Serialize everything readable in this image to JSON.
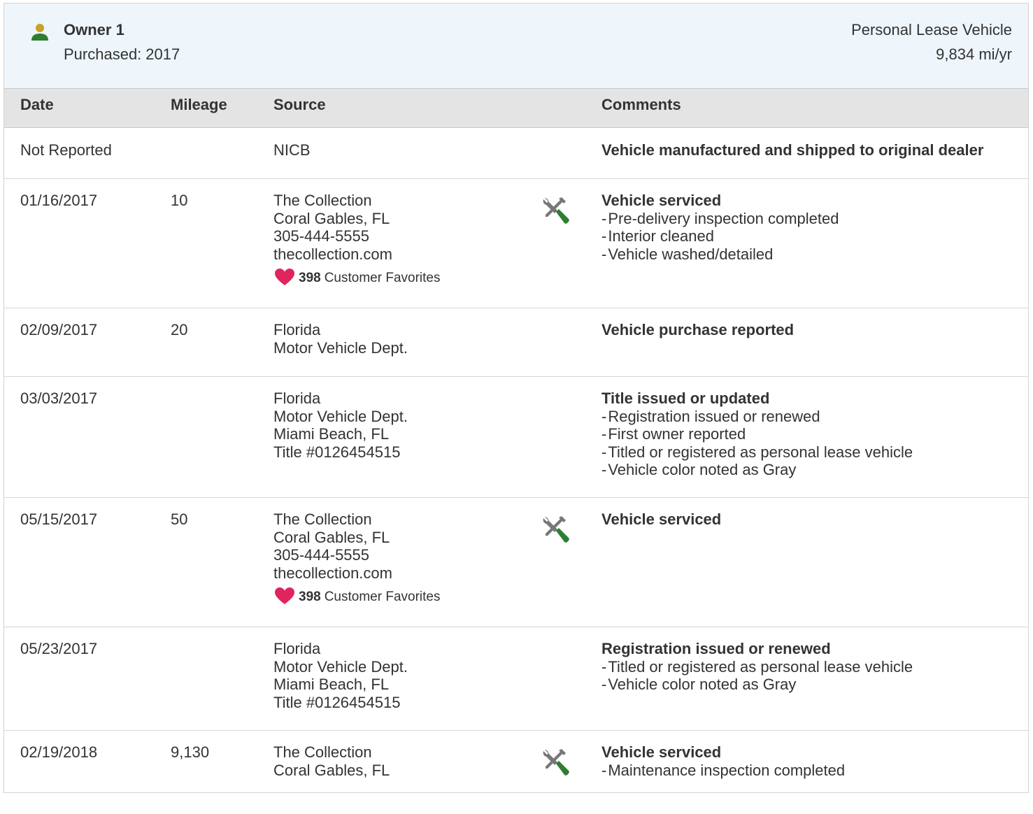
{
  "owner": {
    "title": "Owner 1",
    "purchased_label": "Purchased:",
    "purchased_year": "2017",
    "vehicle_type": "Personal Lease Vehicle",
    "miles_per_year": "9,834 mi/yr"
  },
  "table": {
    "columns": [
      "Date",
      "Mileage",
      "Source",
      "Comments"
    ],
    "rows": [
      {
        "date": "Not Reported",
        "mileage": "",
        "source": [
          "NICB"
        ],
        "favorites": null,
        "service_icon": false,
        "comment_title": "Vehicle manufactured and shipped to original dealer",
        "comment_items": []
      },
      {
        "date": "01/16/2017",
        "mileage": "10",
        "source": [
          "The Collection",
          "Coral Gables, FL",
          "305-444-5555",
          "thecollection.com"
        ],
        "favorites": {
          "count": "398",
          "label": "Customer Favorites"
        },
        "service_icon": true,
        "comment_title": "Vehicle serviced",
        "comment_items": [
          "Pre-delivery inspection completed",
          "Interior cleaned",
          "Vehicle washed/detailed"
        ]
      },
      {
        "date": "02/09/2017",
        "mileage": "20",
        "source": [
          "Florida",
          "Motor Vehicle Dept."
        ],
        "favorites": null,
        "service_icon": false,
        "comment_title": "Vehicle purchase reported",
        "comment_items": []
      },
      {
        "date": "03/03/2017",
        "mileage": "",
        "source": [
          "Florida",
          "Motor Vehicle Dept.",
          "Miami Beach, FL",
          "Title #0126454515"
        ],
        "favorites": null,
        "service_icon": false,
        "comment_title": "Title issued or updated",
        "comment_items": [
          "Registration issued or renewed",
          "First owner reported",
          "Titled or registered as personal lease vehicle",
          "Vehicle color noted as Gray"
        ]
      },
      {
        "date": "05/15/2017",
        "mileage": "50",
        "source": [
          "The Collection",
          "Coral Gables, FL",
          "305-444-5555",
          "thecollection.com"
        ],
        "favorites": {
          "count": "398",
          "label": "Customer Favorites"
        },
        "service_icon": true,
        "comment_title": "Vehicle serviced",
        "comment_items": []
      },
      {
        "date": "05/23/2017",
        "mileage": "",
        "source": [
          "Florida",
          "Motor Vehicle Dept.",
          "Miami Beach, FL",
          "Title #0126454515"
        ],
        "favorites": null,
        "service_icon": false,
        "comment_title": "Registration issued or renewed",
        "comment_items": [
          "Titled or registered as personal lease vehicle",
          "Vehicle color noted as Gray"
        ]
      },
      {
        "date": "02/19/2018",
        "mileage": "9,130",
        "source": [
          "The Collection",
          "Coral Gables, FL"
        ],
        "favorites": null,
        "service_icon": true,
        "comment_title": "Vehicle serviced",
        "comment_items": [
          "Maintenance inspection completed"
        ]
      }
    ]
  },
  "colors": {
    "header_bg": "#eef5fb",
    "table_head_bg": "#e4e4e4",
    "person_icon_head": "#c9a227",
    "person_icon_body": "#2e7d32",
    "heart": "#e0245e",
    "wrench_green": "#2e7d32",
    "tool_gray": "#777777"
  },
  "icons": [
    "person-icon",
    "heart-icon",
    "service-tools-icon"
  ]
}
